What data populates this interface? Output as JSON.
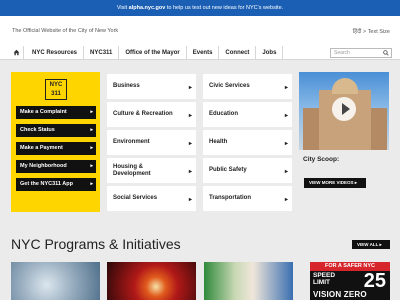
{
  "topbar": {
    "prefix": "Visit ",
    "link": "alpha.nyc.gov",
    "suffix": " to help us test out new ideas for NYC's website."
  },
  "header": {
    "tagline": "The Official Website of the City of New York",
    "language": "हिंदी > Text Size"
  },
  "nav": {
    "items": [
      "NYC Resources",
      "NYC311",
      "Office of the Mayor",
      "Events",
      "Connect",
      "Jobs"
    ],
    "search_placeholder": "Search"
  },
  "nyc311": {
    "logo_line1": "NYC",
    "logo_line2": "311",
    "buttons": [
      "Make a Complaint",
      "Check Status",
      "Make a Payment",
      "My Neighborhood",
      "Get the NYC311 App"
    ]
  },
  "categories": {
    "col1": [
      "Business",
      "Culture & Recreation",
      "Environment",
      "Housing & Development",
      "Social Services"
    ],
    "col2": [
      "Civic Services",
      "Education",
      "Health",
      "Public Safety",
      "Transportation"
    ]
  },
  "video": {
    "caption": "City Scoop:",
    "more_label": "VIEW MORE VIDEOS"
  },
  "programs": {
    "title": "NYC Programs & Initiatives",
    "view_all": "VIEW ALL",
    "vision_zero": {
      "banner": "FOR A SAFER NYC",
      "speed": "SPEED",
      "limit": "LIMIT",
      "number": "25",
      "vz": "VISION ZERO"
    }
  },
  "colors": {
    "topbar": "#1a5fb4",
    "yellow": "#ffd500",
    "black": "#111111",
    "red": "#d7262b"
  },
  "icons": {
    "home": "home-icon",
    "search": "search-icon",
    "arrow": "arrow-right-icon",
    "play": "play-icon"
  }
}
